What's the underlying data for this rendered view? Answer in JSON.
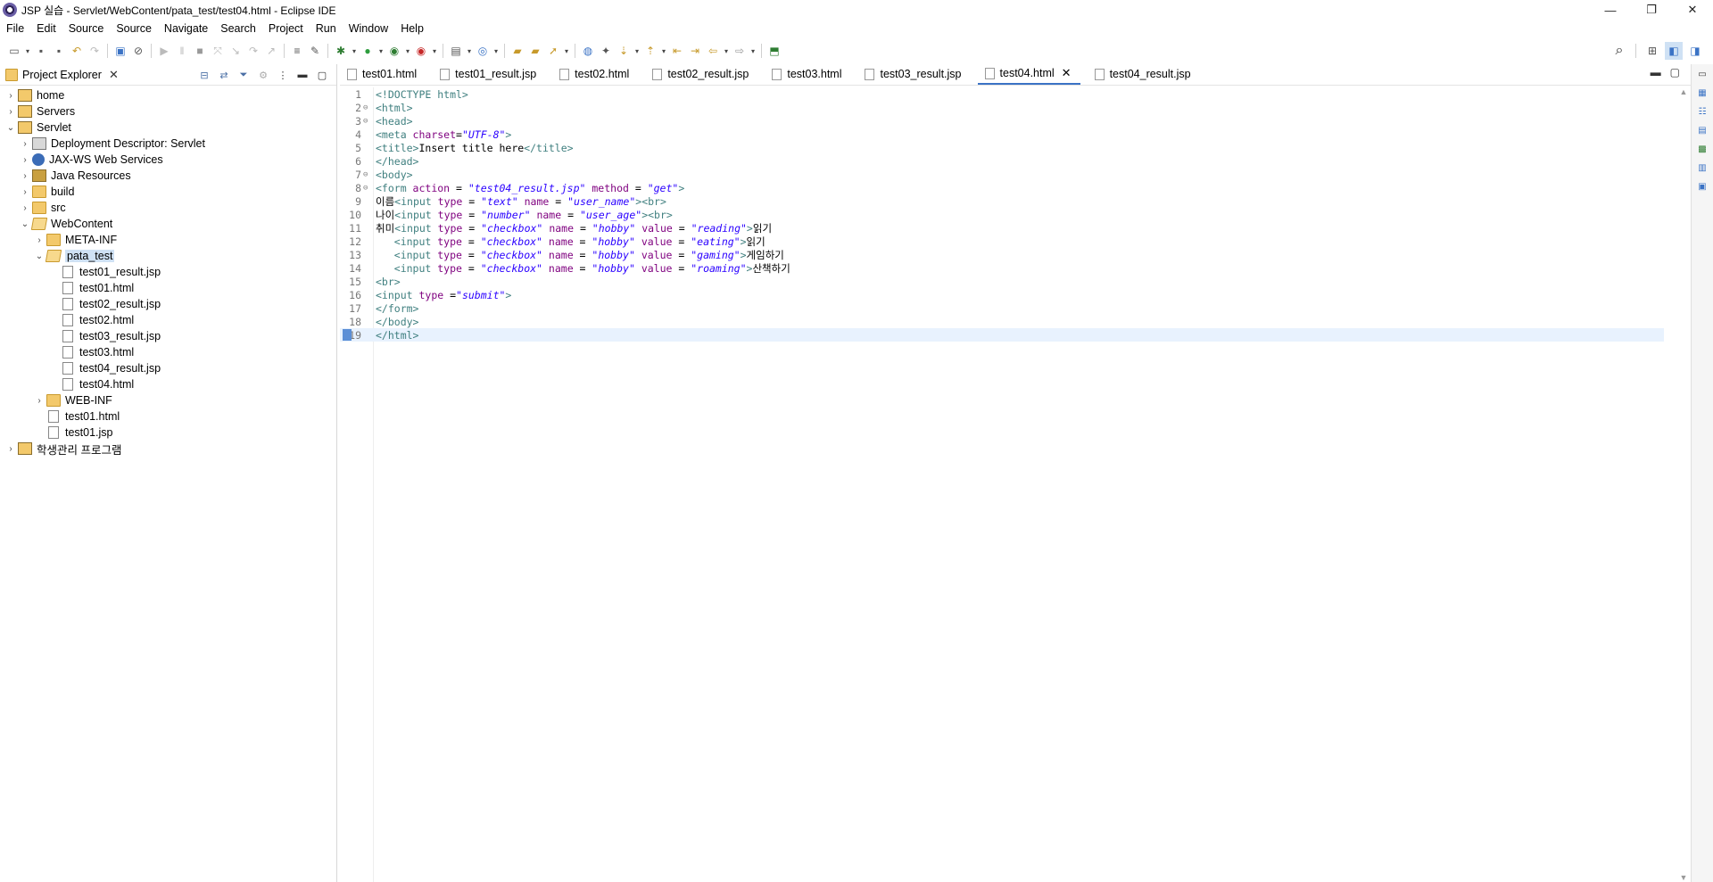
{
  "window": {
    "title": "JSP 실습 - Servlet/WebContent/pata_test/test04.html - Eclipse IDE",
    "minimize": "—",
    "restore": "❐",
    "close": "✕"
  },
  "menu": [
    "File",
    "Edit",
    "Source",
    "Source",
    "Navigate",
    "Search",
    "Project",
    "Run",
    "Window",
    "Help"
  ],
  "explorer": {
    "tab_label": "Project Explorer",
    "tree": [
      {
        "label": "home",
        "depth": 0,
        "twisty": "›",
        "icon": "project"
      },
      {
        "label": "Servers",
        "depth": 0,
        "twisty": "›",
        "icon": "project"
      },
      {
        "label": "Servlet",
        "depth": 0,
        "twisty": "⌄",
        "icon": "project"
      },
      {
        "label": "Deployment Descriptor: Servlet",
        "depth": 1,
        "twisty": "›",
        "icon": "descriptor"
      },
      {
        "label": "JAX-WS Web Services",
        "depth": 1,
        "twisty": "›",
        "icon": "webservice"
      },
      {
        "label": "Java Resources",
        "depth": 1,
        "twisty": "›",
        "icon": "java-resources"
      },
      {
        "label": "build",
        "depth": 1,
        "twisty": "›",
        "icon": "folder"
      },
      {
        "label": "src",
        "depth": 1,
        "twisty": "›",
        "icon": "folder"
      },
      {
        "label": "WebContent",
        "depth": 1,
        "twisty": "⌄",
        "icon": "folder-open"
      },
      {
        "label": "META-INF",
        "depth": 2,
        "twisty": "›",
        "icon": "folder"
      },
      {
        "label": "pata_test",
        "depth": 2,
        "twisty": "⌄",
        "icon": "folder-open",
        "selected": true
      },
      {
        "label": "test01_result.jsp",
        "depth": 3,
        "twisty": "",
        "icon": "file"
      },
      {
        "label": "test01.html",
        "depth": 3,
        "twisty": "",
        "icon": "file"
      },
      {
        "label": "test02_result.jsp",
        "depth": 3,
        "twisty": "",
        "icon": "file"
      },
      {
        "label": "test02.html",
        "depth": 3,
        "twisty": "",
        "icon": "file"
      },
      {
        "label": "test03_result.jsp",
        "depth": 3,
        "twisty": "",
        "icon": "file"
      },
      {
        "label": "test03.html",
        "depth": 3,
        "twisty": "",
        "icon": "file"
      },
      {
        "label": "test04_result.jsp",
        "depth": 3,
        "twisty": "",
        "icon": "file"
      },
      {
        "label": "test04.html",
        "depth": 3,
        "twisty": "",
        "icon": "file"
      },
      {
        "label": "WEB-INF",
        "depth": 2,
        "twisty": "›",
        "icon": "folder"
      },
      {
        "label": "test01.html",
        "depth": 2,
        "twisty": "",
        "icon": "file"
      },
      {
        "label": "test01.jsp",
        "depth": 2,
        "twisty": "",
        "icon": "file"
      },
      {
        "label": "학생관리 프로그램",
        "depth": 0,
        "twisty": "›",
        "icon": "project"
      }
    ]
  },
  "editor": {
    "tabs": [
      {
        "label": "test01.html",
        "active": false
      },
      {
        "label": "test01_result.jsp",
        "active": false
      },
      {
        "label": "test02.html",
        "active": false
      },
      {
        "label": "test02_result.jsp",
        "active": false
      },
      {
        "label": "test03.html",
        "active": false
      },
      {
        "label": "test03_result.jsp",
        "active": false
      },
      {
        "label": "test04.html",
        "active": true
      },
      {
        "label": "test04_result.jsp",
        "active": false
      }
    ],
    "current_line": 19,
    "lines": [
      {
        "n": "1",
        "fold": "",
        "parts": [
          [
            "tag",
            "<!DOCTYPE html>"
          ]
        ]
      },
      {
        "n": "2",
        "fold": "⊖",
        "parts": [
          [
            "tag",
            "<html>"
          ]
        ]
      },
      {
        "n": "3",
        "fold": "⊖",
        "parts": [
          [
            "tag",
            "<head>"
          ]
        ]
      },
      {
        "n": "4",
        "fold": "",
        "parts": [
          [
            "tag",
            "<meta "
          ],
          [
            "attr",
            "charset"
          ],
          [
            "txt",
            "="
          ],
          [
            "str",
            "\"UTF-8\""
          ],
          [
            "tag",
            ">"
          ]
        ]
      },
      {
        "n": "5",
        "fold": "",
        "parts": [
          [
            "tag",
            "<title>"
          ],
          [
            "txt",
            "Insert title here"
          ],
          [
            "tag",
            "</title>"
          ]
        ]
      },
      {
        "n": "6",
        "fold": "",
        "parts": [
          [
            "tag",
            "</head>"
          ]
        ]
      },
      {
        "n": "7",
        "fold": "⊖",
        "parts": [
          [
            "tag",
            "<body>"
          ]
        ]
      },
      {
        "n": "8",
        "fold": "⊖",
        "parts": [
          [
            "tag",
            "<form "
          ],
          [
            "attr",
            "action"
          ],
          [
            "txt",
            " = "
          ],
          [
            "str",
            "\"test04_result.jsp\""
          ],
          [
            "txt",
            " "
          ],
          [
            "attr",
            "method"
          ],
          [
            "txt",
            " = "
          ],
          [
            "str",
            "\"get\""
          ],
          [
            "tag",
            ">"
          ]
        ]
      },
      {
        "n": "9",
        "fold": "",
        "parts": [
          [
            "txt",
            "이름"
          ],
          [
            "tag",
            "<input "
          ],
          [
            "attr",
            "type"
          ],
          [
            "txt",
            " = "
          ],
          [
            "str",
            "\"text\""
          ],
          [
            "txt",
            " "
          ],
          [
            "attr",
            "name"
          ],
          [
            "txt",
            " = "
          ],
          [
            "str",
            "\"user_name\""
          ],
          [
            "tag",
            "><br>"
          ]
        ]
      },
      {
        "n": "10",
        "fold": "",
        "parts": [
          [
            "txt",
            "나이"
          ],
          [
            "tag",
            "<input "
          ],
          [
            "attr",
            "type"
          ],
          [
            "txt",
            " = "
          ],
          [
            "str",
            "\"number\""
          ],
          [
            "txt",
            " "
          ],
          [
            "attr",
            "name"
          ],
          [
            "txt",
            " = "
          ],
          [
            "str",
            "\"user_age\""
          ],
          [
            "tag",
            "><br>"
          ]
        ]
      },
      {
        "n": "11",
        "fold": "",
        "parts": [
          [
            "txt",
            "취미"
          ],
          [
            "tag",
            "<input "
          ],
          [
            "attr",
            "type"
          ],
          [
            "txt",
            " = "
          ],
          [
            "str",
            "\"checkbox\""
          ],
          [
            "txt",
            " "
          ],
          [
            "attr",
            "name"
          ],
          [
            "txt",
            " = "
          ],
          [
            "str",
            "\"hobby\""
          ],
          [
            "txt",
            " "
          ],
          [
            "attr",
            "value"
          ],
          [
            "txt",
            " = "
          ],
          [
            "str",
            "\"reading\""
          ],
          [
            "tag",
            ">"
          ],
          [
            "txt",
            "읽기"
          ]
        ]
      },
      {
        "n": "12",
        "fold": "",
        "parts": [
          [
            "txt",
            "   "
          ],
          [
            "tag",
            "<input "
          ],
          [
            "attr",
            "type"
          ],
          [
            "txt",
            " = "
          ],
          [
            "str",
            "\"checkbox\""
          ],
          [
            "txt",
            " "
          ],
          [
            "attr",
            "name"
          ],
          [
            "txt",
            " = "
          ],
          [
            "str",
            "\"hobby\""
          ],
          [
            "txt",
            " "
          ],
          [
            "attr",
            "value"
          ],
          [
            "txt",
            " = "
          ],
          [
            "str",
            "\"eating\""
          ],
          [
            "tag",
            ">"
          ],
          [
            "txt",
            "읽기"
          ]
        ]
      },
      {
        "n": "13",
        "fold": "",
        "parts": [
          [
            "txt",
            "   "
          ],
          [
            "tag",
            "<input "
          ],
          [
            "attr",
            "type"
          ],
          [
            "txt",
            " = "
          ],
          [
            "str",
            "\"checkbox\""
          ],
          [
            "txt",
            " "
          ],
          [
            "attr",
            "name"
          ],
          [
            "txt",
            " = "
          ],
          [
            "str",
            "\"hobby\""
          ],
          [
            "txt",
            " "
          ],
          [
            "attr",
            "value"
          ],
          [
            "txt",
            " = "
          ],
          [
            "str",
            "\"gaming\""
          ],
          [
            "tag",
            ">"
          ],
          [
            "txt",
            "게임하기"
          ]
        ]
      },
      {
        "n": "14",
        "fold": "",
        "parts": [
          [
            "txt",
            "   "
          ],
          [
            "tag",
            "<input "
          ],
          [
            "attr",
            "type"
          ],
          [
            "txt",
            " = "
          ],
          [
            "str",
            "\"checkbox\""
          ],
          [
            "txt",
            " "
          ],
          [
            "attr",
            "name"
          ],
          [
            "txt",
            " = "
          ],
          [
            "str",
            "\"hobby\""
          ],
          [
            "txt",
            " "
          ],
          [
            "attr",
            "value"
          ],
          [
            "txt",
            " = "
          ],
          [
            "str",
            "\"roaming\""
          ],
          [
            "tag",
            ">"
          ],
          [
            "txt",
            "산책하기"
          ]
        ]
      },
      {
        "n": "15",
        "fold": "",
        "parts": [
          [
            "tag",
            "<br>"
          ]
        ]
      },
      {
        "n": "16",
        "fold": "",
        "parts": [
          [
            "tag",
            "<input "
          ],
          [
            "attr",
            "type"
          ],
          [
            "txt",
            " ="
          ],
          [
            "str",
            "\"submit\""
          ],
          [
            "tag",
            ">"
          ]
        ]
      },
      {
        "n": "17",
        "fold": "",
        "parts": [
          [
            "tag",
            "</form>"
          ]
        ]
      },
      {
        "n": "18",
        "fold": "",
        "parts": [
          [
            "tag",
            "</body>"
          ]
        ]
      },
      {
        "n": "19",
        "fold": "",
        "parts": [
          [
            "tag",
            "</html>"
          ]
        ]
      }
    ]
  },
  "icons": {
    "search": "⌕",
    "up_arrow": "▲",
    "down_arrow": "▼"
  }
}
